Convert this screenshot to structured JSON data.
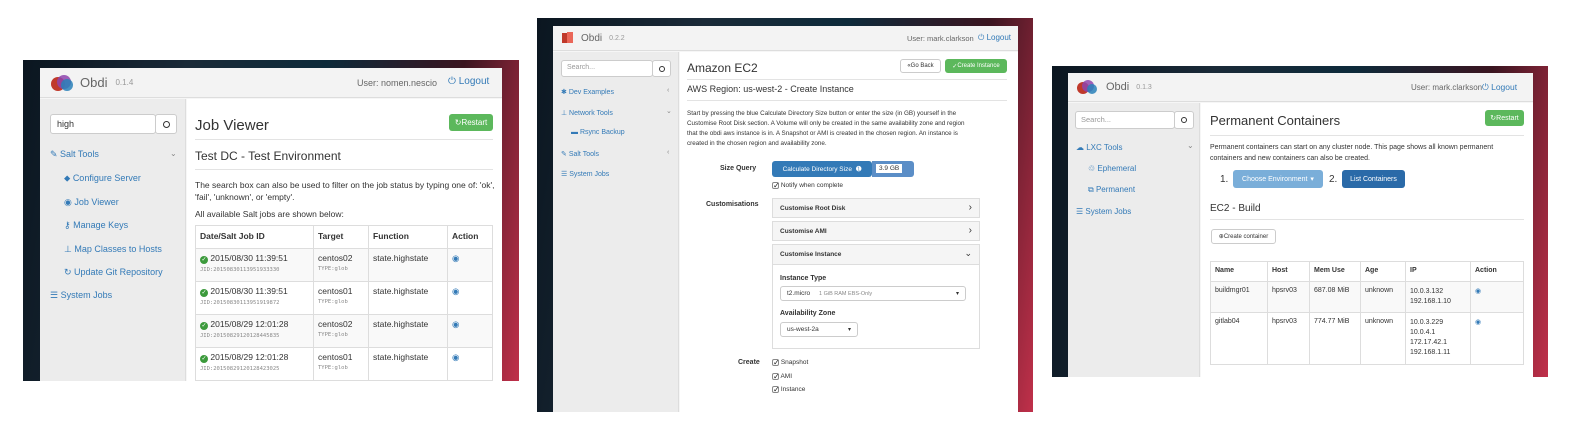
{
  "left": {
    "app": {
      "name": "Obdi",
      "version": "0.1.4"
    },
    "user_label": "User: nomen.nescio",
    "logout_label": "Logout",
    "search": {
      "value": "high"
    },
    "sidebar": {
      "salt_tools": "Salt Tools",
      "items": [
        {
          "label": "Configure Server",
          "icon": "tag-icon"
        },
        {
          "label": "Job Viewer",
          "icon": "eye-icon"
        },
        {
          "label": "Manage Keys",
          "icon": "key-icon"
        },
        {
          "label": "Map Classes to Hosts",
          "icon": "sitemap-icon"
        },
        {
          "label": "Update Git Repository",
          "icon": "refresh-icon"
        }
      ],
      "system_jobs": "System Jobs"
    },
    "main": {
      "title": "Job Viewer",
      "restart_label": "Restart",
      "subtitle": "Test DC - Test Environment",
      "desc1": "The search box can also be used to filter on the job status by typing one of: 'ok',",
      "desc2": "'fail', 'unknown', or 'empty'.",
      "desc3": "All available Salt jobs are shown below:",
      "columns": [
        "Date/Salt Job ID",
        "Target",
        "Function",
        "Action"
      ],
      "rows": [
        {
          "date": "2015/08/30 11:39:51",
          "jid": "JID:20150830113951933330",
          "target": "centos02",
          "type": "TYPE:glob",
          "func": "state.highstate"
        },
        {
          "date": "2015/08/30 11:39:51",
          "jid": "JID:20150830113951919872",
          "target": "centos01",
          "type": "TYPE:glob",
          "func": "state.highstate"
        },
        {
          "date": "2015/08/29 12:01:28",
          "jid": "JID:20150829120128445835",
          "target": "centos02",
          "type": "TYPE:glob",
          "func": "state.highstate"
        },
        {
          "date": "2015/08/29 12:01:28",
          "jid": "JID:20150829120128423025",
          "target": "centos01",
          "type": "TYPE:glob",
          "func": "state.highstate"
        }
      ]
    }
  },
  "middle": {
    "app": {
      "name": "Obdi",
      "version": "0.2.2"
    },
    "user_label": "User: mark.clarkson",
    "logout_label": "Logout",
    "search": {
      "placeholder": "Search..."
    },
    "sidebar": {
      "dev_examples": "Dev Examples",
      "network_tools": "Network Tools",
      "rsync_backup": "Rsync Backup",
      "salt_tools": "Salt Tools",
      "system_jobs": "System Jobs"
    },
    "main": {
      "title": "Amazon EC2",
      "go_back_label": "Go Back",
      "create_instance_label": "Create Instance",
      "subtitle": "AWS Region: us-west-2 - Create Instance",
      "desc": [
        "Start by pressing the blue Calculate Directory Size button or enter the size (in GB) yourself in the",
        "Customise Root Disk section. A Volume will only be created in the same availability zone and region",
        "that the obdi aws instance is in. A Snapshot or AMI is created in the chosen region. An instance is",
        "created in the chosen region and availability zone."
      ],
      "size_query_label": "Size Query",
      "calc_label": "Calculate Directory Size",
      "size_value": "3.9 GB",
      "notify_label": "Notify when complete",
      "customisations_label": "Customisations",
      "panels": [
        "Customise Root Disk",
        "Customise AMI",
        "Customise Instance"
      ],
      "instance_type_label": "Instance Type",
      "instance_type_value": "t2.micro",
      "instance_type_desc": "1 GiB RAM EBS-Only",
      "az_label": "Availability Zone",
      "az_value": "us-west-2a",
      "create_label": "Create",
      "create_options": [
        "Snapshot",
        "AMI",
        "Instance"
      ]
    }
  },
  "right": {
    "app": {
      "name": "Obdi",
      "version": "0.1.3"
    },
    "user_label": "User: mark.clarkson",
    "logout_label": "Logout",
    "search": {
      "placeholder": "Search..."
    },
    "sidebar": {
      "lxc_tools": "LXC Tools",
      "ephemeral": "Ephemeral",
      "permanent": "Permanent",
      "system_jobs": "System Jobs"
    },
    "main": {
      "title": "Permanent Containers",
      "restart_label": "Restart",
      "desc1": "Permanent containers can start on any cluster node. This page shows all known permanent",
      "desc2": "containers and new containers can also be created.",
      "step1": "1.",
      "choose_env_label": "Choose Environment",
      "step2": "2.",
      "list_containers_label": "List Containers",
      "section_title": "EC2 - Build",
      "create_container_label": "Create container",
      "columns": [
        "Name",
        "Host",
        "Mem Use",
        "Age",
        "IP",
        "Action"
      ],
      "rows": [
        {
          "name": "buildmgr01",
          "host": "hpsrv03",
          "mem": "687.08 MiB",
          "age": "unknown",
          "ip": [
            "10.0.3.132",
            "192.168.1.10"
          ]
        },
        {
          "name": "gitlab04",
          "host": "hpsrv03",
          "mem": "774.77 MiB",
          "age": "unknown",
          "ip": [
            "10.0.3.229",
            "10.0.4.1",
            "172.17.42.1",
            "192.168.1.11"
          ]
        }
      ]
    }
  },
  "colors": {
    "link": "#337ab7",
    "success": "#5cb85c",
    "primary": "#337ab7"
  }
}
